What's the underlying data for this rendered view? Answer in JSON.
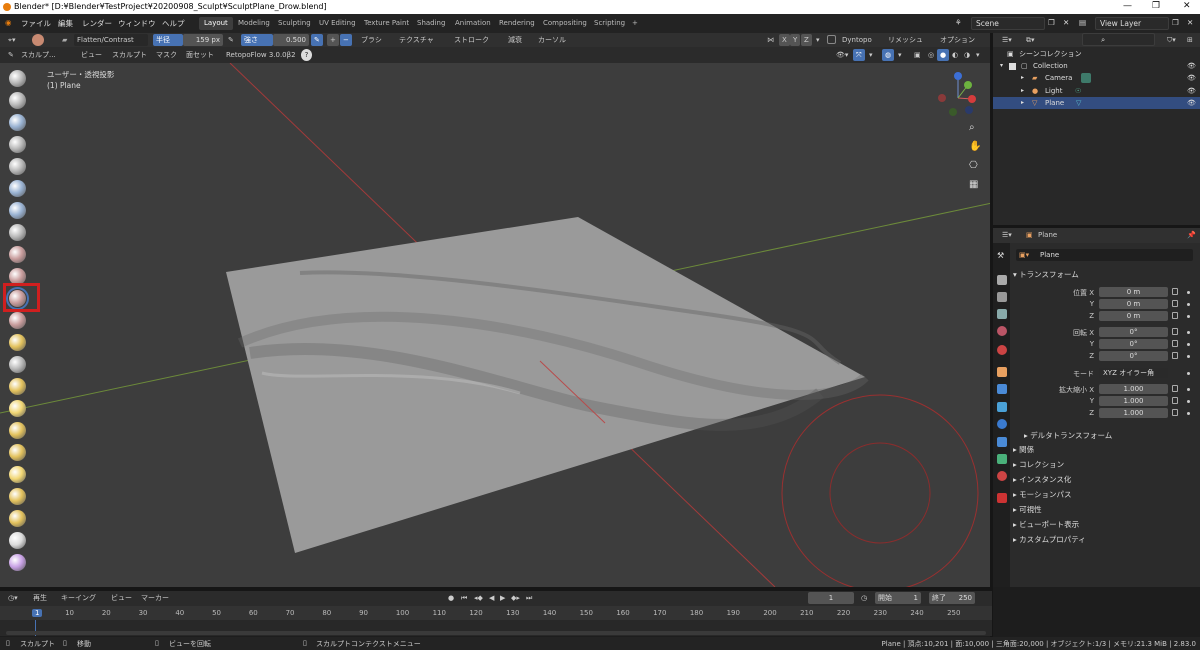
{
  "window": {
    "title": "Blender* [D:¥Blender¥TestProject¥20200908_Sculpt¥SculptPlane_Drow.blend]",
    "minimize": "—",
    "maximize": "❐",
    "close": "✕"
  },
  "menu": [
    "ファイル",
    "編集",
    "レンダー",
    "ウィンドウ",
    "ヘルプ"
  ],
  "workspaces": [
    "Layout",
    "Modeling",
    "Sculpting",
    "UV Editing",
    "Texture Paint",
    "Shading",
    "Animation",
    "Rendering",
    "Compositing",
    "Scripting",
    "+"
  ],
  "active_workspace": "Layout",
  "scene": {
    "name": "Scene",
    "view_layer": "View Layer"
  },
  "tool_header": {
    "brush_name": "Flatten/Contrast",
    "radius_label": "半径",
    "radius_value": "159 px",
    "strength_label": "強さ",
    "strength_value": "0.500",
    "plus": "+",
    "minus": "−",
    "brush_menu": "ブラシ",
    "texture_menu": "テクスチャ",
    "stroke_menu": "ストローク",
    "falloff_menu": "減衰",
    "cursor_menu": "カーソル",
    "x": "X",
    "y": "Y",
    "z": "Z",
    "dyntopo": "Dyntopo",
    "remesh": "リメッシュ",
    "options": "オプション"
  },
  "mode_header": {
    "mode": "スカルプ...",
    "view": "ビュー",
    "sculpt": "スカルプト",
    "mask": "マスク",
    "face_sets": "面セット",
    "addon": "RetopoFlow 3.0.0β2",
    "help": "?"
  },
  "viewport": {
    "view_label": "ユーザー・透視投影",
    "object_label": "(1) Plane",
    "gizmo": {
      "x": "X",
      "y": "Y",
      "z": "Z"
    }
  },
  "tools": [
    {
      "name": "draw-brush-icon",
      "color": "#b9b9b9"
    },
    {
      "name": "draw-sharp-brush-icon",
      "color": "#b9b9b9"
    },
    {
      "name": "clay-brush-icon",
      "color": "#9ab3d3"
    },
    {
      "name": "clay-strips-brush-icon",
      "color": "#b9b9b9"
    },
    {
      "name": "clay-thumb-brush-icon",
      "color": "#b9b9b9"
    },
    {
      "name": "layer-brush-icon",
      "color": "#9ab3d3"
    },
    {
      "name": "inflate-brush-icon",
      "color": "#9ab3d3"
    },
    {
      "name": "blob-brush-icon",
      "color": "#b9b9b9"
    },
    {
      "name": "crease-brush-icon",
      "color": "#c99d9d"
    },
    {
      "name": "smooth-brush-icon",
      "color": "#c99d9d"
    },
    {
      "name": "flatten-brush-icon",
      "color": "#c99d9d"
    },
    {
      "name": "fill-brush-icon",
      "color": "#c99d9d"
    },
    {
      "name": "scrape-brush-icon",
      "color": "#e3c25d"
    },
    {
      "name": "multiplane-scrape-brush-icon",
      "color": "#b9b9b9"
    },
    {
      "name": "pinch-brush-icon",
      "color": "#e3c25d"
    },
    {
      "name": "grab-brush-icon",
      "color": "#f2d774"
    },
    {
      "name": "elastic-deform-brush-icon",
      "color": "#e3c25d"
    },
    {
      "name": "snake-hook-brush-icon",
      "color": "#e3c25d"
    },
    {
      "name": "thumb-brush-icon",
      "color": "#f2d774"
    },
    {
      "name": "pose-brush-icon",
      "color": "#e3c25d"
    },
    {
      "name": "nudge-brush-icon",
      "color": "#e3c25d"
    },
    {
      "name": "rotate-brush-icon",
      "color": "#dcdcdc"
    },
    {
      "name": "mask-brush-icon",
      "color": "#c9a2e6"
    }
  ],
  "outliner": {
    "header": "シーンコレクション",
    "rows": [
      {
        "label": "Collection",
        "icon": "collection-icon"
      },
      {
        "label": "Camera",
        "icon": "camera-icon"
      },
      {
        "label": "Light",
        "icon": "light-icon"
      },
      {
        "label": "Plane",
        "icon": "mesh-icon"
      }
    ]
  },
  "properties": {
    "object_name": "Plane",
    "object_field": "Plane",
    "transform_header": "トランスフォーム",
    "location_label": "位置 X",
    "rotation_label": "回転 X",
    "scale_label": "拡大縮小 X",
    "mode_label": "モード",
    "y": "Y",
    "z": "Z",
    "location": [
      "0 m",
      "0 m",
      "0 m"
    ],
    "rotation": [
      "0°",
      "0°",
      "0°"
    ],
    "rotation_mode": "XYZ オイラー角",
    "scale": [
      "1.000",
      "1.000",
      "1.000"
    ],
    "delta": "デルタトランスフォーム",
    "sections": [
      "関係",
      "コレクション",
      "インスタンス化",
      "モーションパス",
      "可視性",
      "ビューポート表示",
      "カスタムプロパティ"
    ]
  },
  "timeline": {
    "playback": "再生",
    "keying": "キーイング",
    "view": "ビュー",
    "marker": "マーカー",
    "current_frame": "1",
    "start_label": "開始",
    "start": "1",
    "end_label": "終了",
    "end": "250",
    "ticks": [
      "1",
      "10",
      "20",
      "30",
      "40",
      "50",
      "60",
      "70",
      "80",
      "90",
      "100",
      "110",
      "120",
      "130",
      "140",
      "150",
      "160",
      "170",
      "180",
      "190",
      "200",
      "210",
      "220",
      "230",
      "240",
      "250"
    ]
  },
  "statusbar": {
    "left": "スカルプト",
    "move": "移動",
    "rotate_view": "ビューを回転",
    "context_menu": "スカルプトコンテクストメニュー",
    "stats": "Plane | 頂点:10,201 | 面:10,000 | 三角面:20,000 | オブジェクト:1/3 | メモリ:21.3 MiB | 2.83.0"
  }
}
